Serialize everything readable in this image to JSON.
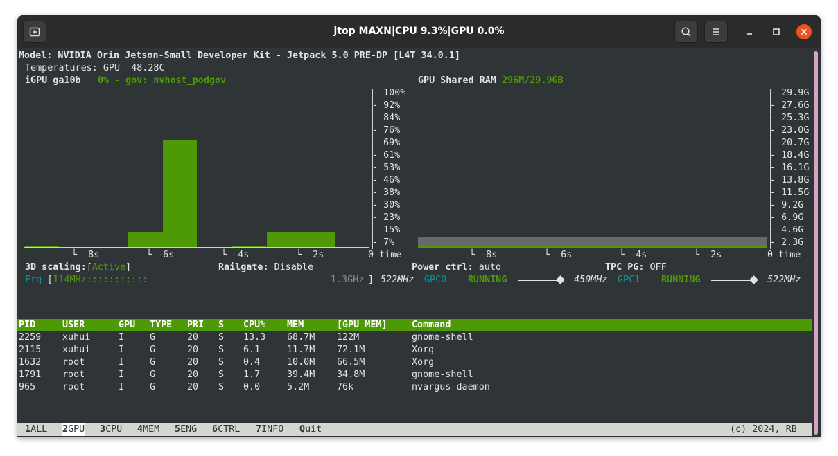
{
  "window": {
    "title": "jtop MAXN|CPU 9.3%|GPU 0.0%"
  },
  "header": {
    "model": "Model: NVIDIA Orin Jetson-Small Developer Kit - Jetpack 5.0 PRE-DP [L4T 34.0.1]",
    "temps_label": "Temperatures: GPU",
    "temps_value": "48.28C"
  },
  "gpu_panel": {
    "name": "iGPU ga10b",
    "status": "0% - gov: nvhost_podgov",
    "y_ticks": [
      "100%",
      "92%",
      "84%",
      "76%",
      "69%",
      "61%",
      "53%",
      "46%",
      "38%",
      "30%",
      "23%",
      "15%",
      "7%"
    ],
    "x_ticks": [
      "-8s",
      "-6s",
      "-4s",
      "-2s"
    ],
    "x_zero": "0 time"
  },
  "ram_panel": {
    "label": "GPU Shared RAM",
    "value": "296M/29.9GB",
    "y_ticks": [
      "29.9G",
      "27.6G",
      "25.3G",
      "23.0G",
      "20.7G",
      "18.4G",
      "16.1G",
      "13.8G",
      "11.5G",
      "9.2G",
      "6.9G",
      "4.6G",
      "2.3G"
    ],
    "x_ticks": [
      "-8s",
      "-6s",
      "-4s",
      "-2s"
    ],
    "x_zero": "0 time"
  },
  "chart_data": {
    "type": "bar",
    "title": "iGPU ga10b",
    "xlabel": "time",
    "x": [
      "-10s",
      "-9s",
      "-8s",
      "-7s",
      "-6s",
      "-5s",
      "-4s",
      "-3s",
      "-2s",
      "-1s"
    ],
    "values": [
      1,
      0,
      0,
      9,
      67,
      0,
      1,
      9,
      9,
      0
    ],
    "ylim": [
      0,
      100
    ],
    "ylabel_unit": "%",
    "series_ram": {
      "name": "GPU Shared RAM",
      "used_gb": 0.296,
      "total_gb": 29.9
    }
  },
  "status": {
    "scaling_label": "3D scaling:",
    "scaling_value": "Active",
    "railgate_label": "Railgate:",
    "railgate_value": "Disable",
    "power_label": "Power ctrl:",
    "power_value": "auto",
    "tpc_label": "TPC PG:",
    "tpc_value": "OFF"
  },
  "freq": {
    "label": "Frq",
    "current": "114MHz",
    "dots": ":::::::::::",
    "max": "1.3GHz",
    "end": "522MHz",
    "gpc0_label": "GPC0",
    "gpc0_state": "RUNNING",
    "gpc0_freq": "450MHz",
    "gpc1_label": "GPC1",
    "gpc1_state": "RUNNING",
    "gpc1_freq": "522MHz"
  },
  "table": {
    "columns": [
      "PID",
      "USER",
      "GPU",
      "TYPE",
      "PRI",
      "S",
      "CPU%",
      "MEM",
      "[GPU MEM]",
      "Command"
    ],
    "rows": [
      [
        "2259",
        "xuhui",
        "I",
        "G",
        "20",
        "S",
        "13.3",
        "68.7M",
        "122M",
        "gnome-shell"
      ],
      [
        "2115",
        "xuhui",
        "I",
        "G",
        "20",
        "S",
        "6.1",
        "11.7M",
        "72.1M",
        "Xorg"
      ],
      [
        "1632",
        "root",
        "I",
        "G",
        "20",
        "S",
        "0.4",
        "10.0M",
        "66.5M",
        "Xorg"
      ],
      [
        "1791",
        "root",
        "I",
        "G",
        "20",
        "S",
        "1.7",
        "39.4M",
        "34.8M",
        "gnome-shell"
      ],
      [
        "965",
        "root",
        "I",
        "G",
        "20",
        "S",
        "0.0",
        "5.2M",
        "76k",
        "nvargus-daemon"
      ]
    ]
  },
  "menu": {
    "items": [
      {
        "key": "1",
        "label": "ALL"
      },
      {
        "key": "2",
        "label": "GPU"
      },
      {
        "key": "3",
        "label": "CPU"
      },
      {
        "key": "4",
        "label": "MEM"
      },
      {
        "key": "5",
        "label": "ENG"
      },
      {
        "key": "6",
        "label": "CTRL"
      },
      {
        "key": "7",
        "label": "INFO"
      },
      {
        "key": "Q",
        "label": "uit"
      }
    ],
    "active_index": 1,
    "copyright": "(c) 2024, RB"
  },
  "colors": {
    "accent": "#4e9a06",
    "teal": "#06989a",
    "close": "#e95420",
    "bg": "#2f3436"
  },
  "icons": [
    "new-tab-icon",
    "search-icon",
    "hamburger-menu-icon",
    "minimize-icon",
    "maximize-icon",
    "close-icon"
  ]
}
